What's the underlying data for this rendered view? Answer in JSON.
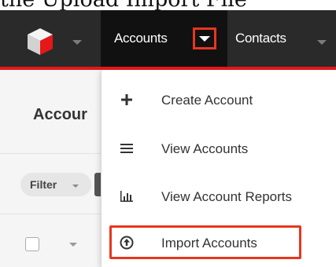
{
  "caption": "the Upload Import File",
  "nav": {
    "accounts_label": "Accounts",
    "contacts_label": "Contacts"
  },
  "page": {
    "title": "Accour",
    "filter_label": "Filter"
  },
  "menu": {
    "items": [
      {
        "label": "Create Account",
        "icon": "plus-icon"
      },
      {
        "label": "View Accounts",
        "icon": "list-icon"
      },
      {
        "label": "View Account Reports",
        "icon": "bar-chart-icon"
      },
      {
        "label": "Import Accounts",
        "icon": "import-icon"
      }
    ]
  },
  "colors": {
    "navbar_bg": "#2a2a2a",
    "active_nav_bg": "#111111",
    "brand_red": "#e61718",
    "highlight_red": "#e8361e"
  }
}
